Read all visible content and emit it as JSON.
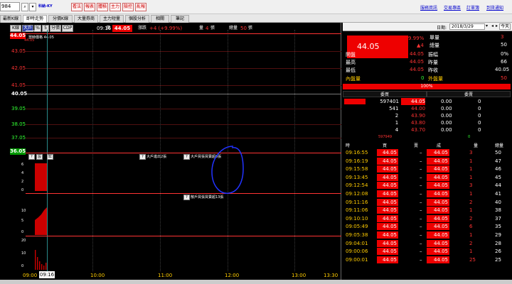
{
  "topbar": {
    "code": "984",
    "stock_name": "科納",
    "stock_tag": "-KY",
    "tools": [
      "看法",
      "報表",
      "體積",
      "主力",
      "險控",
      "亂報"
    ],
    "links": [
      "服務資訊",
      "交易專區",
      "訂單簿",
      "到貨通知"
    ]
  },
  "tabs": [
    "最新K線",
    "即時走勢",
    "分價K線",
    "大量券商",
    "主力短量",
    "個股分析",
    "相關",
    "筆記"
  ],
  "active_tab": 1,
  "chart": {
    "toolbar": [
      "K線",
      "大戶",
      "%",
      "5",
      "分價",
      "CDP"
    ],
    "time": "09:16",
    "price_label": "價",
    "price": "44.05",
    "change_label": "漲跌",
    "change": "+4 (+9.99%)",
    "vol_label": "量",
    "vol": "4",
    "vol_unit": "張",
    "total_label": "總量",
    "total": "50",
    "total_unit": "張",
    "y_labels": [
      "44.05",
      "43.05",
      "42.05",
      "41.05",
      "40.05",
      "39.05",
      "38.05",
      "37.05",
      "36.05"
    ],
    "top_note": "當時價格 44.05",
    "price_line_label": "44.05",
    "sub1_btns": [
      "?",
      "設",
      "缸"
    ],
    "sub1_notes": [
      "大戶進出2張",
      "大戶買張買賣超6張"
    ],
    "sub1_y": [
      "6",
      "4",
      "2",
      "0"
    ],
    "sub2_notes": [
      "散戶買張買賣超13張"
    ],
    "sub2_y": [
      "10",
      "5",
      "0"
    ],
    "sub3_y": [
      "20",
      "10",
      "0"
    ],
    "time_labels": [
      "09:00",
      "10:00",
      "11:00",
      "12:00",
      "13:00",
      "13:30"
    ],
    "cursor_time": "09:16",
    "line_color": "#3333ff"
  },
  "quote": {
    "date_label": "日期:",
    "date": "2018/3/29",
    "today_btn": "今天",
    "big_price": "44.05",
    "pct": "9.99%",
    "chg": "▲4",
    "labels": [
      "單量",
      "總量",
      "開盤",
      "振幅",
      "最高",
      "昨量",
      "最低",
      "昨收"
    ],
    "single_vol": "3",
    "total_vol": "50",
    "open": "44.05",
    "amplitude": "0%",
    "high": "44.05",
    "prev_vol": "66",
    "low": "44.05",
    "prev_close": "40.05",
    "inner_label": "內盤量",
    "inner": "0",
    "outer_label": "外盤量",
    "outer": "50",
    "ratio_bar": "100%",
    "bid_hdr": "委買",
    "ask_hdr": "委賣",
    "book": [
      {
        "qty": "597401",
        "price": "44.05",
        "ask_p": "0.00",
        "ask_q": "0"
      },
      {
        "qty": "541",
        "price": "44.00",
        "ask_p": "0.00",
        "ask_q": "0"
      },
      {
        "qty": "2",
        "price": "43.90",
        "ask_p": "0.00",
        "ask_q": "0"
      },
      {
        "qty": "1",
        "price": "43.80",
        "ask_p": "0.00",
        "ask_q": "0"
      },
      {
        "qty": "4",
        "price": "43.70",
        "ask_p": "0.00",
        "ask_q": "0"
      }
    ],
    "book_total_bid": "597949",
    "book_total_ask": "0",
    "tick_hdrs": [
      "時",
      "買",
      "賣",
      "成",
      "量",
      "總量"
    ],
    "ticks": [
      {
        "t": "09:16:55",
        "b": "44.05",
        "d": "44.05",
        "v": "3",
        "tot": "50"
      },
      {
        "t": "09:16:19",
        "b": "44.05",
        "d": "44.05",
        "v": "1",
        "tot": "47"
      },
      {
        "t": "09:15:58",
        "b": "44.05",
        "d": "44.05",
        "v": "1",
        "tot": "46"
      },
      {
        "t": "09:13:45",
        "b": "44.05",
        "d": "44.05",
        "v": "1",
        "tot": "45"
      },
      {
        "t": "09:12:54",
        "b": "44.05",
        "d": "44.05",
        "v": "3",
        "tot": "44"
      },
      {
        "t": "09:12:08",
        "b": "44.05",
        "d": "44.05",
        "v": "1",
        "tot": "41"
      },
      {
        "t": "09:11:16",
        "b": "44.05",
        "d": "44.05",
        "v": "2",
        "tot": "40"
      },
      {
        "t": "09:11:06",
        "b": "44.05",
        "d": "44.05",
        "v": "1",
        "tot": "38"
      },
      {
        "t": "09:10:10",
        "b": "44.05",
        "d": "44.05",
        "v": "2",
        "tot": "37"
      },
      {
        "t": "09:05:49",
        "b": "44.05",
        "d": "44.05",
        "v": "6",
        "tot": "35"
      },
      {
        "t": "09:05:38",
        "b": "44.05",
        "d": "44.05",
        "v": "1",
        "tot": "29"
      },
      {
        "t": "09:04:01",
        "b": "44.05",
        "d": "44.05",
        "v": "2",
        "tot": "28"
      },
      {
        "t": "09:00:06",
        "b": "44.05",
        "d": "44.05",
        "v": "1",
        "tot": "26"
      },
      {
        "t": "09:00:01",
        "b": "44.05",
        "d": "44.05",
        "v": "25",
        "tot": "25"
      }
    ]
  }
}
